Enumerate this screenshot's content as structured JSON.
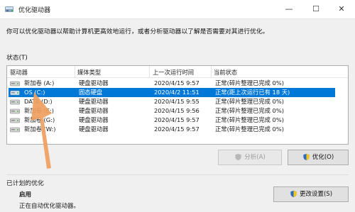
{
  "window": {
    "title": "优化驱动器",
    "minimize_glyph": "—",
    "maximize_glyph": "☐",
    "close_glyph": "✕"
  },
  "description": "你可以优化驱动器以帮助计算机更高效地运行，或者分析驱动器以了解是否需要对其进行优化。",
  "status_section": {
    "label": "状态(T)",
    "columns": [
      "驱动器",
      "媒体类型",
      "上一次运行时间",
      "当前状态"
    ],
    "rows": [
      {
        "drive": "新加卷 (A:)",
        "media": "硬盘驱动器",
        "last_run": "2020/4/15 9:57",
        "status": "正常(碎片整理已完成 0%)",
        "selected": false
      },
      {
        "drive": "OS (C:)",
        "media": "固态硬盘",
        "last_run": "2020/4/2 11:51",
        "status": "正常(距上次运行已有 18 天)",
        "selected": true
      },
      {
        "drive": "DATA (D:)",
        "media": "硬盘驱动器",
        "last_run": "2020/4/15 9:55",
        "status": "正常(碎片整理已完成 0%)",
        "selected": false
      },
      {
        "drive": "新加卷 (E:)",
        "media": "硬盘驱动器",
        "last_run": "2020/4/15 9:56",
        "status": "正常(碎片整理已完成 0%)",
        "selected": false
      },
      {
        "drive": "新加卷 (G:)",
        "media": "硬盘驱动器",
        "last_run": "2020/4/15 9:57",
        "status": "正常(碎片整理已完成 0%)",
        "selected": false
      },
      {
        "drive": "新加卷 (W:)",
        "media": "硬盘驱动器",
        "last_run": "2020/4/15 9:57",
        "status": "正常(碎片整理已完成 0%)",
        "selected": false
      }
    ]
  },
  "buttons": {
    "analyze": "分析(A)",
    "optimize": "优化(O)",
    "change_settings": "更改设置(S)"
  },
  "schedule": {
    "label": "已计划的优化",
    "status": "启用",
    "detail": "正在自动优化驱动器。"
  },
  "icons": {
    "app": "defrag-app-icon",
    "drive": "hard-drive-icon",
    "shield": "uac-shield-icon"
  },
  "colors": {
    "selection": "#0078d7",
    "annotation_arrow": "#f0a060"
  }
}
